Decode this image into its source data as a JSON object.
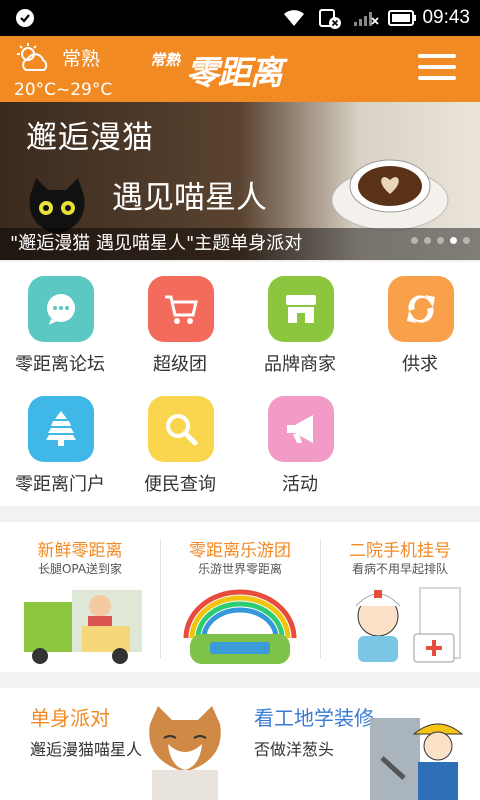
{
  "status": {
    "time": "09:43"
  },
  "header": {
    "city": "常熟",
    "temperature": "20°C~29°C",
    "logo_small": "常熟",
    "logo_big": "零距离"
  },
  "banner": {
    "title": "邂逅漫猫",
    "subtitle": "遇见喵星人",
    "caption": "\"邂逅漫猫 遇见喵星人\"主题单身派对"
  },
  "grid": [
    {
      "label": "零距离论坛",
      "color": "#5cc8c4",
      "icon": "chat-bubble-icon"
    },
    {
      "label": "超级团",
      "color": "#f26b5b",
      "icon": "cart-icon"
    },
    {
      "label": "品牌商家",
      "color": "#8cc63e",
      "icon": "shop-icon"
    },
    {
      "label": "供求",
      "color": "#f9a04a",
      "icon": "exchange-icon"
    },
    {
      "label": "零距离门户",
      "color": "#3fb8e8",
      "icon": "pagoda-icon"
    },
    {
      "label": "便民查询",
      "color": "#f9d64e",
      "icon": "search-icon"
    },
    {
      "label": "活动",
      "color": "#f29bc6",
      "icon": "megaphone-icon"
    }
  ],
  "features": [
    {
      "title": "新鲜零距离",
      "sub": "长腿OPA送到家",
      "color": "#f28a24"
    },
    {
      "title": "零距离乐游团",
      "sub": "乐游世界零距离",
      "color": "#f28a24"
    },
    {
      "title": "二院手机挂号",
      "sub": "看病不用早起排队",
      "color": "#f28a24"
    }
  ],
  "cards": [
    {
      "title": "单身派对",
      "sub": "邂逅漫猫喵星人",
      "color": "#f28a24"
    },
    {
      "title": "看工地学装修",
      "sub": "否做洋葱头",
      "color": "#3a7bd5"
    }
  ]
}
